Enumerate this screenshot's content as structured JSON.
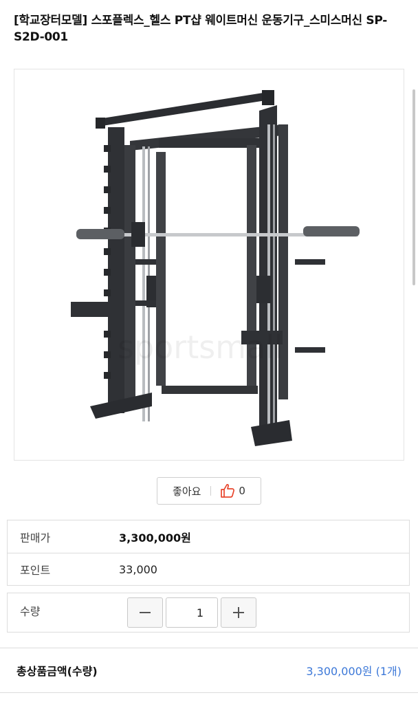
{
  "product": {
    "title": "[학교장터모델] 스포플렉스_헬스 PT샵 웨이트머신 운동기구_스미스머신 SP-S2D-001",
    "image_icon": "smith-machine-product-image"
  },
  "like": {
    "label": "좋아요",
    "count": "0",
    "icon": "thumbs-up-icon",
    "accent": "#e8452c"
  },
  "info": {
    "price_label": "판매가",
    "price_value": "3,300,000원",
    "point_label": "포인트",
    "point_value": "33,000"
  },
  "quantity": {
    "label": "수량",
    "value": "1",
    "minus_icon": "minus-icon",
    "plus_icon": "plus-icon"
  },
  "total": {
    "label": "총상품금액(수량)",
    "value": "3,300,000원 (1개)",
    "color": "#3c78d8"
  }
}
